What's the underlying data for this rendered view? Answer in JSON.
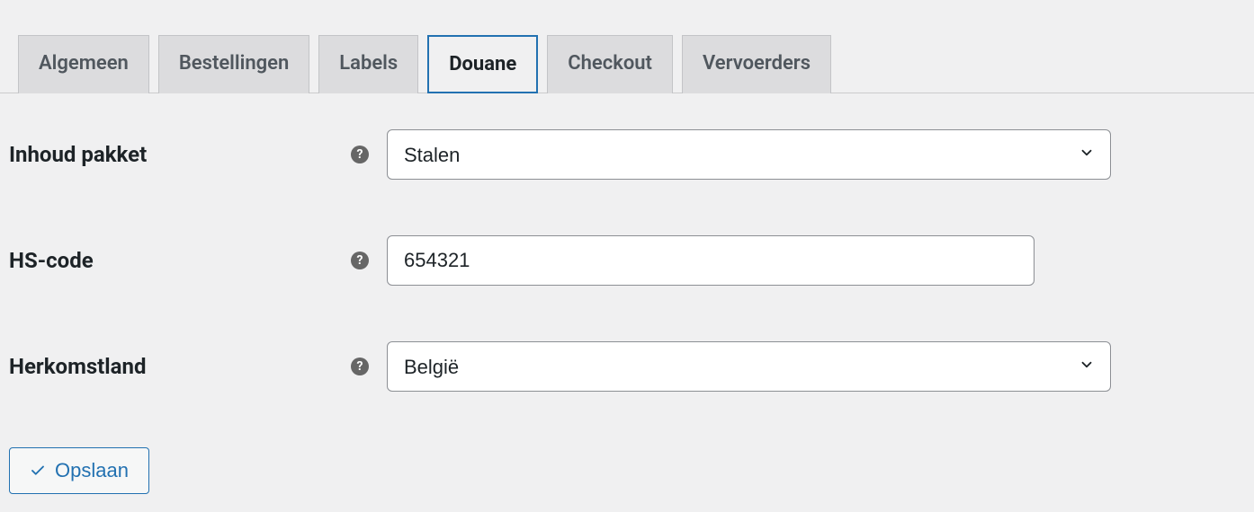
{
  "tabs": {
    "algemeen": "Algemeen",
    "bestellingen": "Bestellingen",
    "labels": "Labels",
    "douane": "Douane",
    "checkout": "Checkout",
    "vervoerders": "Vervoerders"
  },
  "form": {
    "inhoud_pakket": {
      "label": "Inhoud pakket",
      "value": "Stalen"
    },
    "hs_code": {
      "label": "HS-code",
      "value": "654321"
    },
    "herkomstland": {
      "label": "Herkomstland",
      "value": "België"
    }
  },
  "buttons": {
    "save": "Opslaan"
  }
}
